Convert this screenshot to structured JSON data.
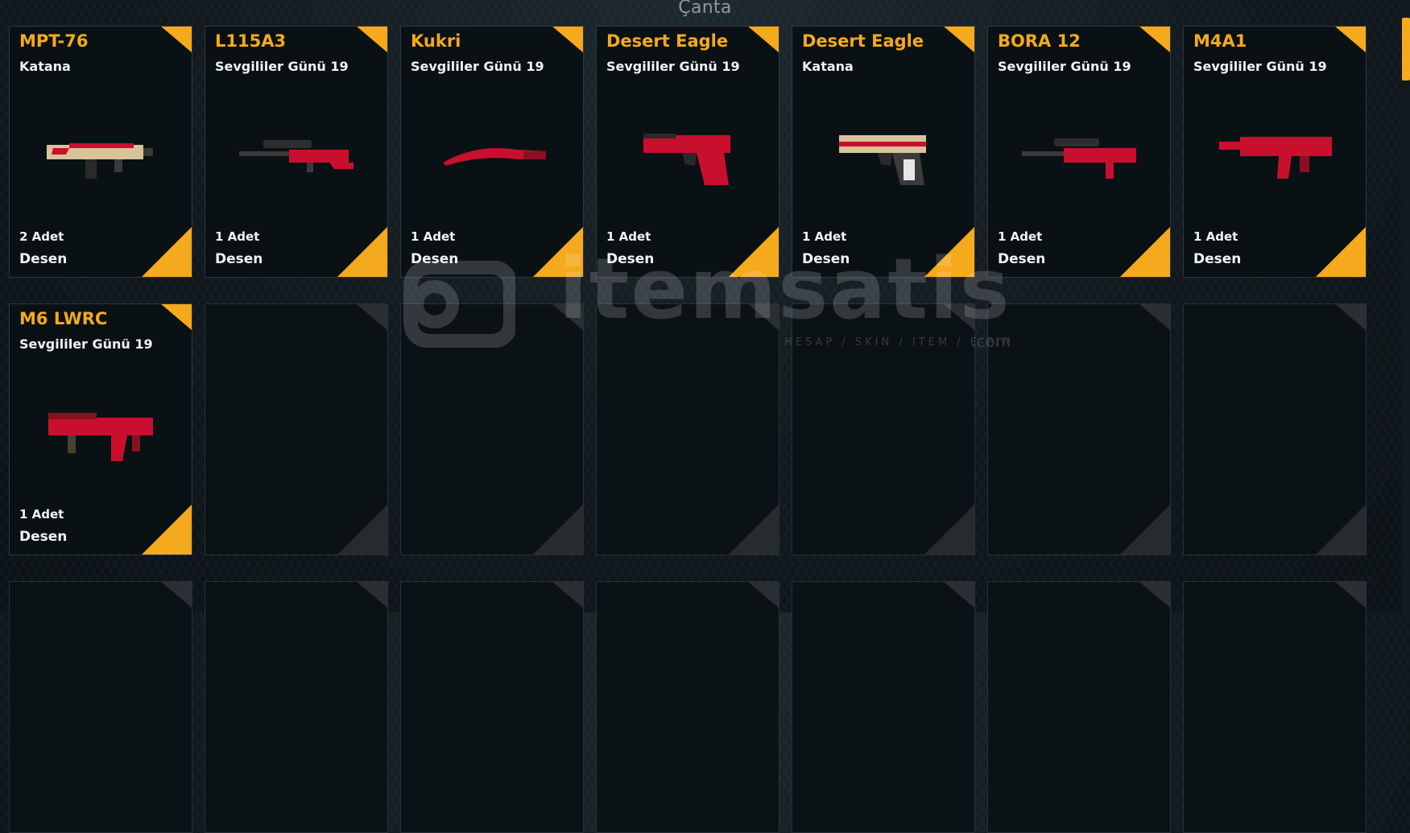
{
  "header": {
    "title": "Çanta"
  },
  "inventory": {
    "cards": [
      {
        "name": "MPT-76",
        "skin": "Katana",
        "count": "2 Adet",
        "type": "Desen",
        "icon": "rifle-icon"
      },
      {
        "name": "L115A3",
        "skin": "Sevgililer Günü 19",
        "count": "1 Adet",
        "type": "Desen",
        "icon": "sniper-icon"
      },
      {
        "name": "Kukri",
        "skin": "Sevgililer Günü 19",
        "count": "1 Adet",
        "type": "Desen",
        "icon": "knife-icon"
      },
      {
        "name": "Desert Eagle",
        "skin": "Sevgililer Günü 19",
        "count": "1 Adet",
        "type": "Desen",
        "icon": "pistol-icon"
      },
      {
        "name": "Desert Eagle",
        "skin": "Katana",
        "count": "1 Adet",
        "type": "Desen",
        "icon": "pistol-icon"
      },
      {
        "name": "BORA 12",
        "skin": "Sevgililer Günü 19",
        "count": "1 Adet",
        "type": "Desen",
        "icon": "sniper-icon"
      },
      {
        "name": "M4A1",
        "skin": "Sevgililer Günü 19",
        "count": "1 Adet",
        "type": "Desen",
        "icon": "smg-icon"
      },
      {
        "name": "M6 LWRC",
        "skin": "Sevgililer Günü 19",
        "count": "1 Adet",
        "type": "Desen",
        "icon": "smg-icon"
      }
    ]
  },
  "watermark": {
    "brand": "itemsatis",
    "tagline": "HESAP / SKIN / ITEM / E-PIN",
    "suffix": ".com"
  },
  "colors": {
    "accent": "#f5a91c",
    "card_bg": "#0a1115",
    "skin_red": "#c8102e"
  }
}
